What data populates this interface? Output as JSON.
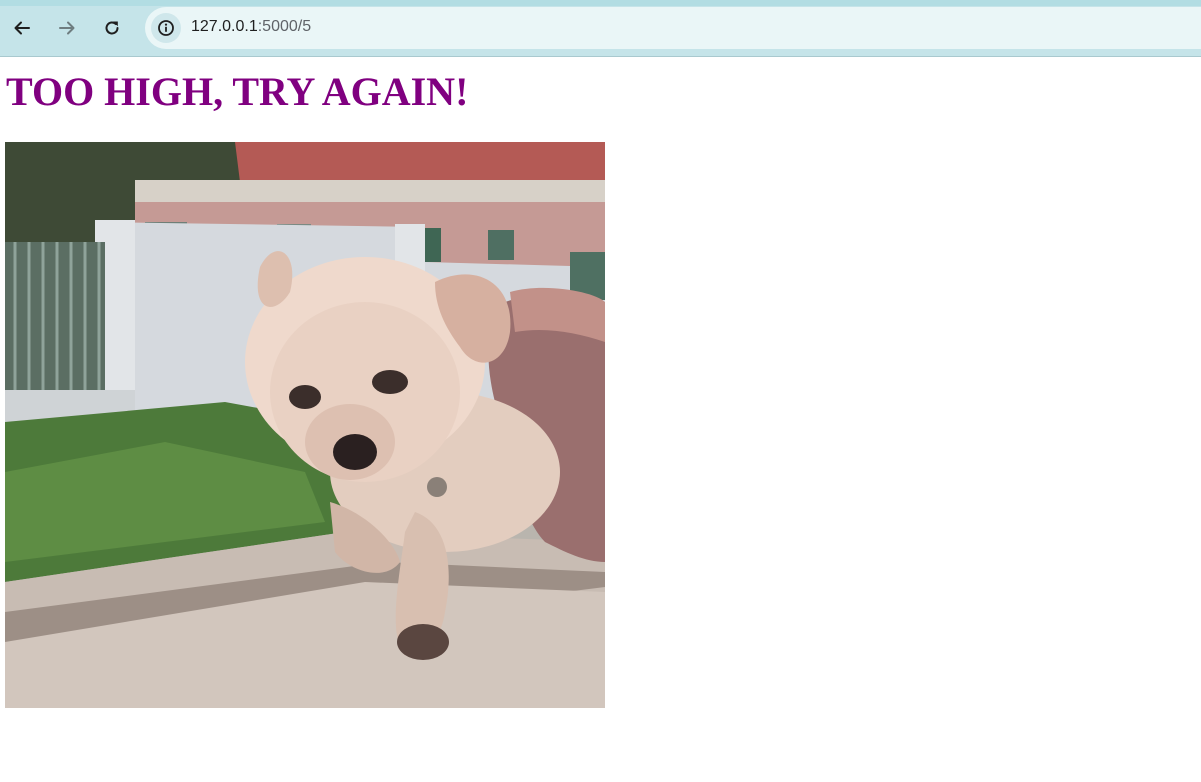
{
  "browser": {
    "url_host": "127.0.0.1",
    "url_path": ":5000/5",
    "icons": {
      "back": "arrow-left-icon",
      "forward": "arrow-right-icon",
      "reload": "reload-icon",
      "site_info": "info-icon"
    }
  },
  "page": {
    "heading": "TOO HIGH, TRY AGAIN!",
    "heading_color": "#800080",
    "image": {
      "subject": "puppy-gif"
    }
  }
}
